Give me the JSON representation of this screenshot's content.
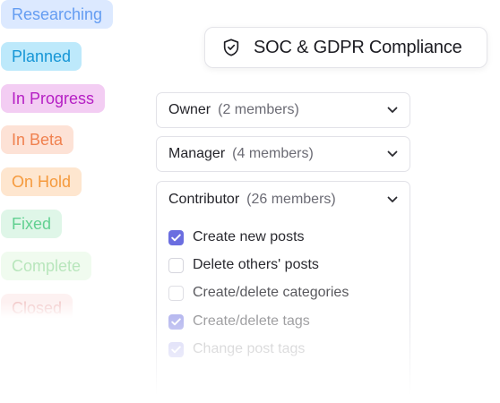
{
  "status_badges": [
    {
      "label": "Researching",
      "bg": "#d6e6ff",
      "fg": "#4a8cf0"
    },
    {
      "label": "Planned",
      "bg": "#bde9fb",
      "fg": "#1696d6"
    },
    {
      "label": "In Progress",
      "bg": "#f3cdf3",
      "fg": "#b51fc4"
    },
    {
      "label": "In Beta",
      "bg": "#fde2d6",
      "fg": "#f0814f"
    },
    {
      "label": "On Hold",
      "bg": "#fee6cf",
      "fg": "#f59a3d"
    },
    {
      "label": "Fixed",
      "bg": "#dcf6e6",
      "fg": "#52cc86"
    },
    {
      "label": "Complete",
      "bg": "#f0fbef",
      "fg": "#b8e6bc"
    },
    {
      "label": "Closed",
      "bg": "#fdf1f1",
      "fg": "#f2c9c9"
    }
  ],
  "compliance": {
    "label": "SOC & GDPR Compliance",
    "icon": "shield-check-icon"
  },
  "roles": [
    {
      "role": "Owner",
      "count": "(2 members)"
    },
    {
      "role": "Manager",
      "count": "(4 members)"
    }
  ],
  "contributor": {
    "role": "Contributor",
    "count": "(26 members)",
    "permissions": [
      {
        "label": "Create new posts",
        "checked": true
      },
      {
        "label": "Delete others' posts",
        "checked": false
      },
      {
        "label": "Create/delete categories",
        "checked": false
      },
      {
        "label": "Create/delete tags",
        "checked": true
      },
      {
        "label": "Change post tags",
        "checked": true
      }
    ]
  },
  "accent_color": "#6b6ee0"
}
